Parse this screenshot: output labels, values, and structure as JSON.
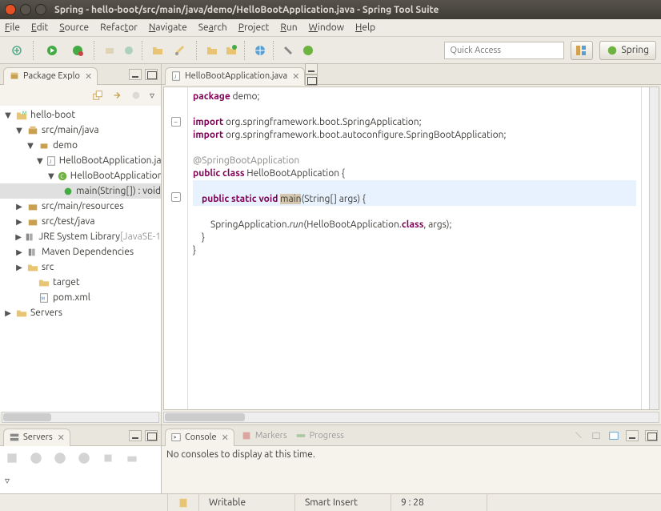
{
  "window": {
    "title": "Spring - hello-boot/src/main/java/demo/HelloBootApplication.java - Spring Tool Suite"
  },
  "menu": {
    "file": "File",
    "edit": "Edit",
    "source": "Source",
    "refactor": "Refactor",
    "navigate": "Navigate",
    "search": "Search",
    "project": "Project",
    "run": "Run",
    "window": "Window",
    "help": "Help"
  },
  "toolbar": {
    "quick_access": "Quick Access",
    "perspective": "Spring"
  },
  "explorer": {
    "tab_label": "Package Explo",
    "items": {
      "root": "hello-boot",
      "srcmainjava": "src/main/java",
      "demo": "demo",
      "file": "HelloBootApplication.jav",
      "class": "HelloBootApplication",
      "method": "main(String[]) : void",
      "srcmainres": "src/main/resources",
      "srctestjava": "src/test/java",
      "jre": "JRE System Library",
      "jre_suffix": "[JavaSE-1",
      "maven": "Maven Dependencies",
      "src": "src",
      "target": "target",
      "pom": "pom.xml",
      "servers": "Servers"
    }
  },
  "editor": {
    "tab": "HelloBootApplication.java",
    "code": {
      "pkg_kw": "package",
      "pkg": "demo;",
      "imp_kw": "import",
      "imp1": "org.springframework.boot.SpringApplication;",
      "imp2": "org.springframework.boot.autoconfigure.SpringBootApplication;",
      "anno": "@SpringBootApplication",
      "public": "public",
      "class": "class",
      "name": "HelloBootApplication",
      "lbrace": "{",
      "static": "static",
      "void": "void",
      "main": "main",
      "args": "(String[] args) {",
      "body": "SpringApplication.",
      "run": "run",
      "body2": "(HelloBootApplication.",
      "classkw": "class",
      "body3": ", args);",
      "rbrace1": "}",
      "rbrace2": "}"
    }
  },
  "servers": {
    "tab": "Servers"
  },
  "console": {
    "tab": "Console",
    "markers": "Markers",
    "progress": "Progress",
    "msg": "No consoles to display at this time."
  },
  "status": {
    "writable": "Writable",
    "insert": "Smart Insert",
    "pos": "9 : 28"
  }
}
